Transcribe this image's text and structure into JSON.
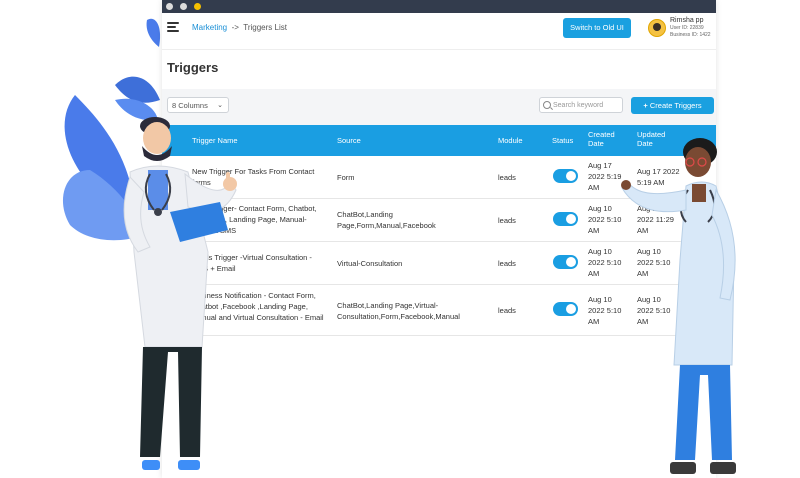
{
  "header": {
    "breadcrumb_link": "Marketing",
    "breadcrumb_sep": "->",
    "breadcrumb_current": "Triggers List",
    "switch_label": "Switch to Old UI",
    "user_name": "Rimsha pp",
    "user_id": "User ID: 22839",
    "business_id": "Business ID: 1422"
  },
  "page": {
    "title": "Triggers"
  },
  "toolbar": {
    "columns_label": "8 Columns",
    "search_placeholder": "Search keyword",
    "create_label": "Create Triggers"
  },
  "table": {
    "headers": [
      "Trigger Name",
      "Source",
      "Module",
      "Status",
      "Created Date",
      "Updated Date"
    ],
    "rows": [
      {
        "name": "New Trigger For Tasks From Contact forms",
        "source": "Form",
        "module": "leads",
        "status": "on",
        "created": "Aug 17 2022 5:19 AM",
        "updated": "Aug 17 2022 5:19 AM"
      },
      {
        "name": "Lead Trigger- Contact Form, Chatbot, Facebook, Landing Page, Manual- Email & SMS",
        "source": "ChatBot,Landing Page,Form,Manual,Facebook",
        "module": "leads",
        "status": "on",
        "created": "Aug 10 2022 5:10 AM",
        "updated": "Aug 10 2022 11:29 AM"
      },
      {
        "name": "Leads Trigger -Virtual Consultation - SMS + Email",
        "source": "Virtual-Consultation",
        "module": "leads",
        "status": "on",
        "created": "Aug 10 2022 5:10 AM",
        "updated": "Aug 10 2022 5:10 AM"
      },
      {
        "name": "Business Notification - Contact Form, Chatbot ,Facebook ,Landing Page, Manual and Virtual Consultation - Email",
        "source": "ChatBot,Landing Page,Virtual-Consultation,Form,Facebook,Manual",
        "module": "leads",
        "status": "on",
        "created": "Aug 10 2022 5:10 AM",
        "updated": "Aug 10 2022 5:10 AM"
      }
    ]
  },
  "colors": {
    "accent": "#1a9ee2",
    "titlebar": "#333c4d",
    "leaf": "#4a86e8"
  },
  "icons": [
    "menu-icon",
    "search-icon",
    "plus-icon",
    "chevron-down-icon",
    "avatar"
  ]
}
